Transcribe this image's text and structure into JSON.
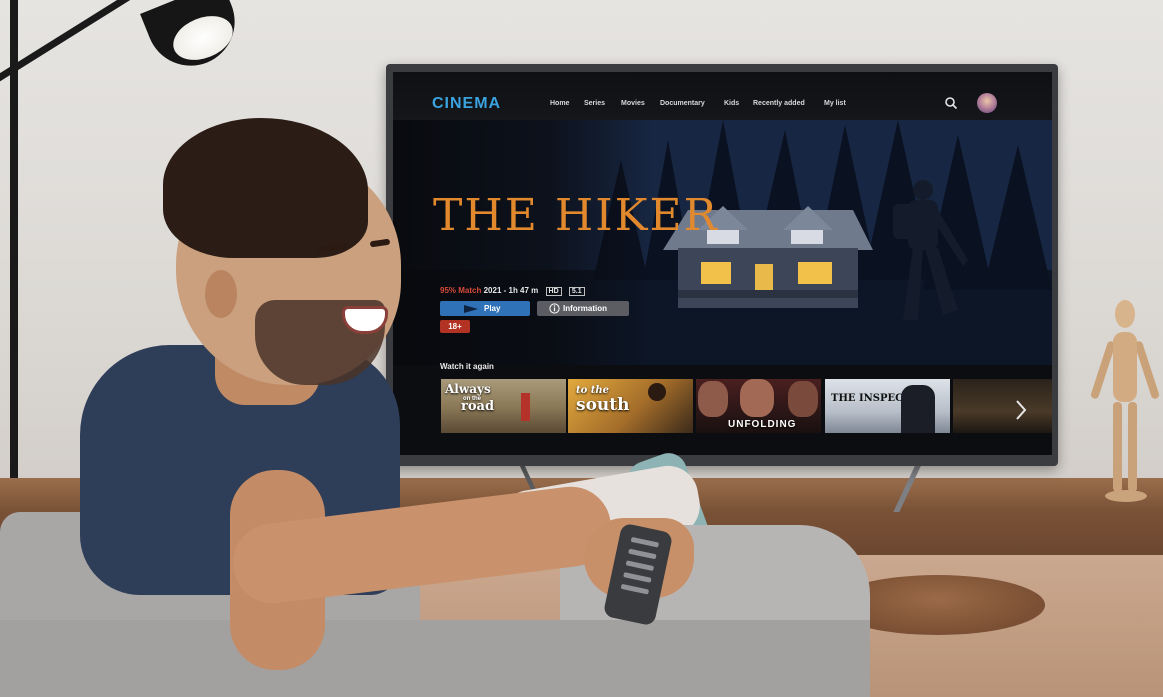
{
  "tv_app": {
    "logo": "CINEMA",
    "nav": [
      "Home",
      "Series",
      "Movies",
      "Documentary",
      "Kids",
      "Recently added",
      "My list"
    ],
    "icons": {
      "search": "search-icon",
      "profile": "avatar"
    },
    "hero": {
      "title": "THE HIKER",
      "match": "95% Match",
      "year_duration": "2021 -  1h 47 m",
      "quality": "HD",
      "audio": "5.1",
      "play_label": "Play",
      "info_label": "Information",
      "age_rating": "18+"
    },
    "row": {
      "title": "Watch it again",
      "items": [
        {
          "title": "Always on the road",
          "line1": "Always",
          "line2": "on the",
          "line3": "road"
        },
        {
          "title": "to the south",
          "line1": "to the",
          "line2": "south"
        },
        {
          "title": "UNFOLDING",
          "line1": "UNFOLDING"
        },
        {
          "title": "THE INSPECTOR",
          "line1": "THE INSPECTOR"
        }
      ],
      "next_icon": "chevron-right-icon"
    }
  },
  "colors": {
    "logo": "#3aa3e0",
    "title": "#e2892d",
    "match": "#d64a3a",
    "play_button": "#2f72b8",
    "info_button": "#5b5d62",
    "age_badge": "#b23223"
  }
}
